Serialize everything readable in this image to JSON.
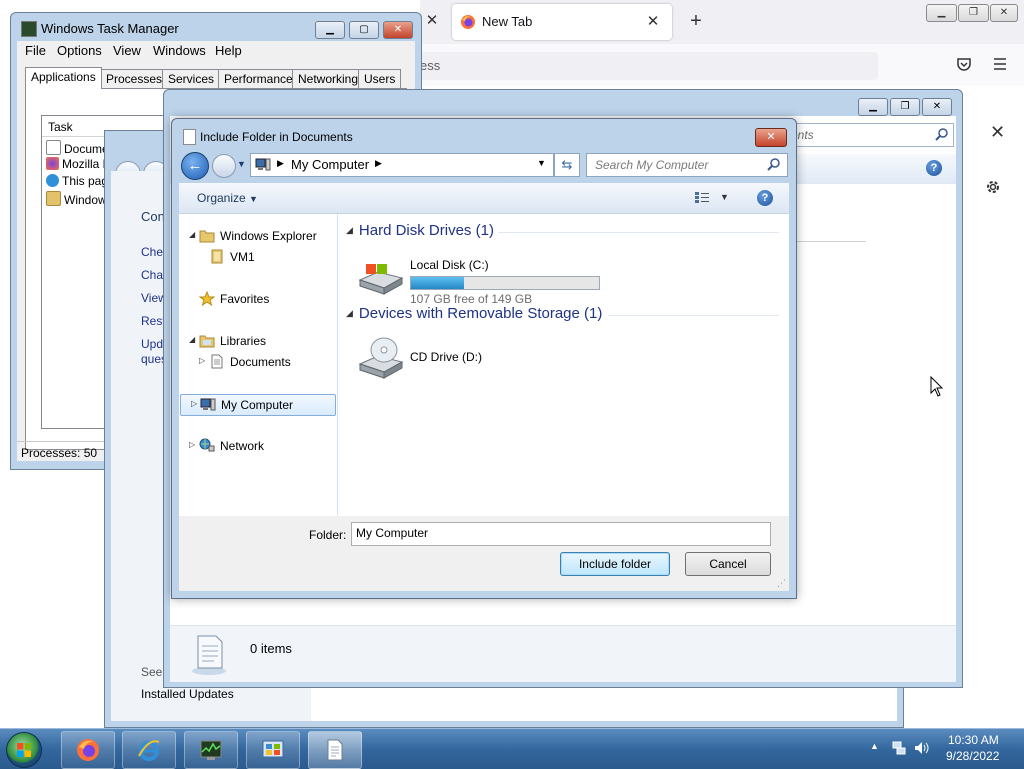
{
  "firefox": {
    "tab_title": "New Tab",
    "url_placeholder_fragment": "ess",
    "search_fragment": "ents"
  },
  "task_manager": {
    "title": "Windows Task Manager",
    "menu": [
      "File",
      "Options",
      "View",
      "Windows",
      "Help"
    ],
    "tabs": [
      "Applications",
      "Processes",
      "Services",
      "Performance",
      "Networking",
      "Users"
    ],
    "active_tab": "Applications",
    "column_task": "Task",
    "tasks": [
      "Documents",
      "Mozilla Firefox",
      "This page",
      "Windows"
    ],
    "status": "Processes: 50"
  },
  "control_panel": {
    "links": [
      "Con",
      "Che",
      "Cha",
      "View",
      "Rest",
      "Upd",
      "ques"
    ],
    "see_also": "See",
    "installed_updates": "Installed Updates"
  },
  "documents_window": {
    "status_items": "0 items"
  },
  "dialog": {
    "title": "Include Folder in Documents",
    "address": "My Computer",
    "search_placeholder": "Search My Computer",
    "organize": "Organize",
    "nav": {
      "windows_explorer": "Windows Explorer",
      "vm1": "VM1",
      "favorites": "Favorites",
      "libraries": "Libraries",
      "documents": "Documents",
      "my_computer": "My Computer",
      "network": "Network"
    },
    "groups": {
      "hard_disks": "Hard Disk Drives (1)",
      "removable": "Devices with Removable Storage (1)"
    },
    "drive_c": {
      "name": "Local Disk (C:)",
      "free": "107 GB free of 149 GB",
      "used_fraction": 0.28
    },
    "drive_d": {
      "name": "CD Drive (D:)"
    },
    "folder_label": "Folder:",
    "folder_value": "My Computer",
    "include_button": "Include folder",
    "cancel_button": "Cancel"
  },
  "taskbar": {
    "time": "10:30 AM",
    "date": "9/28/2022"
  }
}
